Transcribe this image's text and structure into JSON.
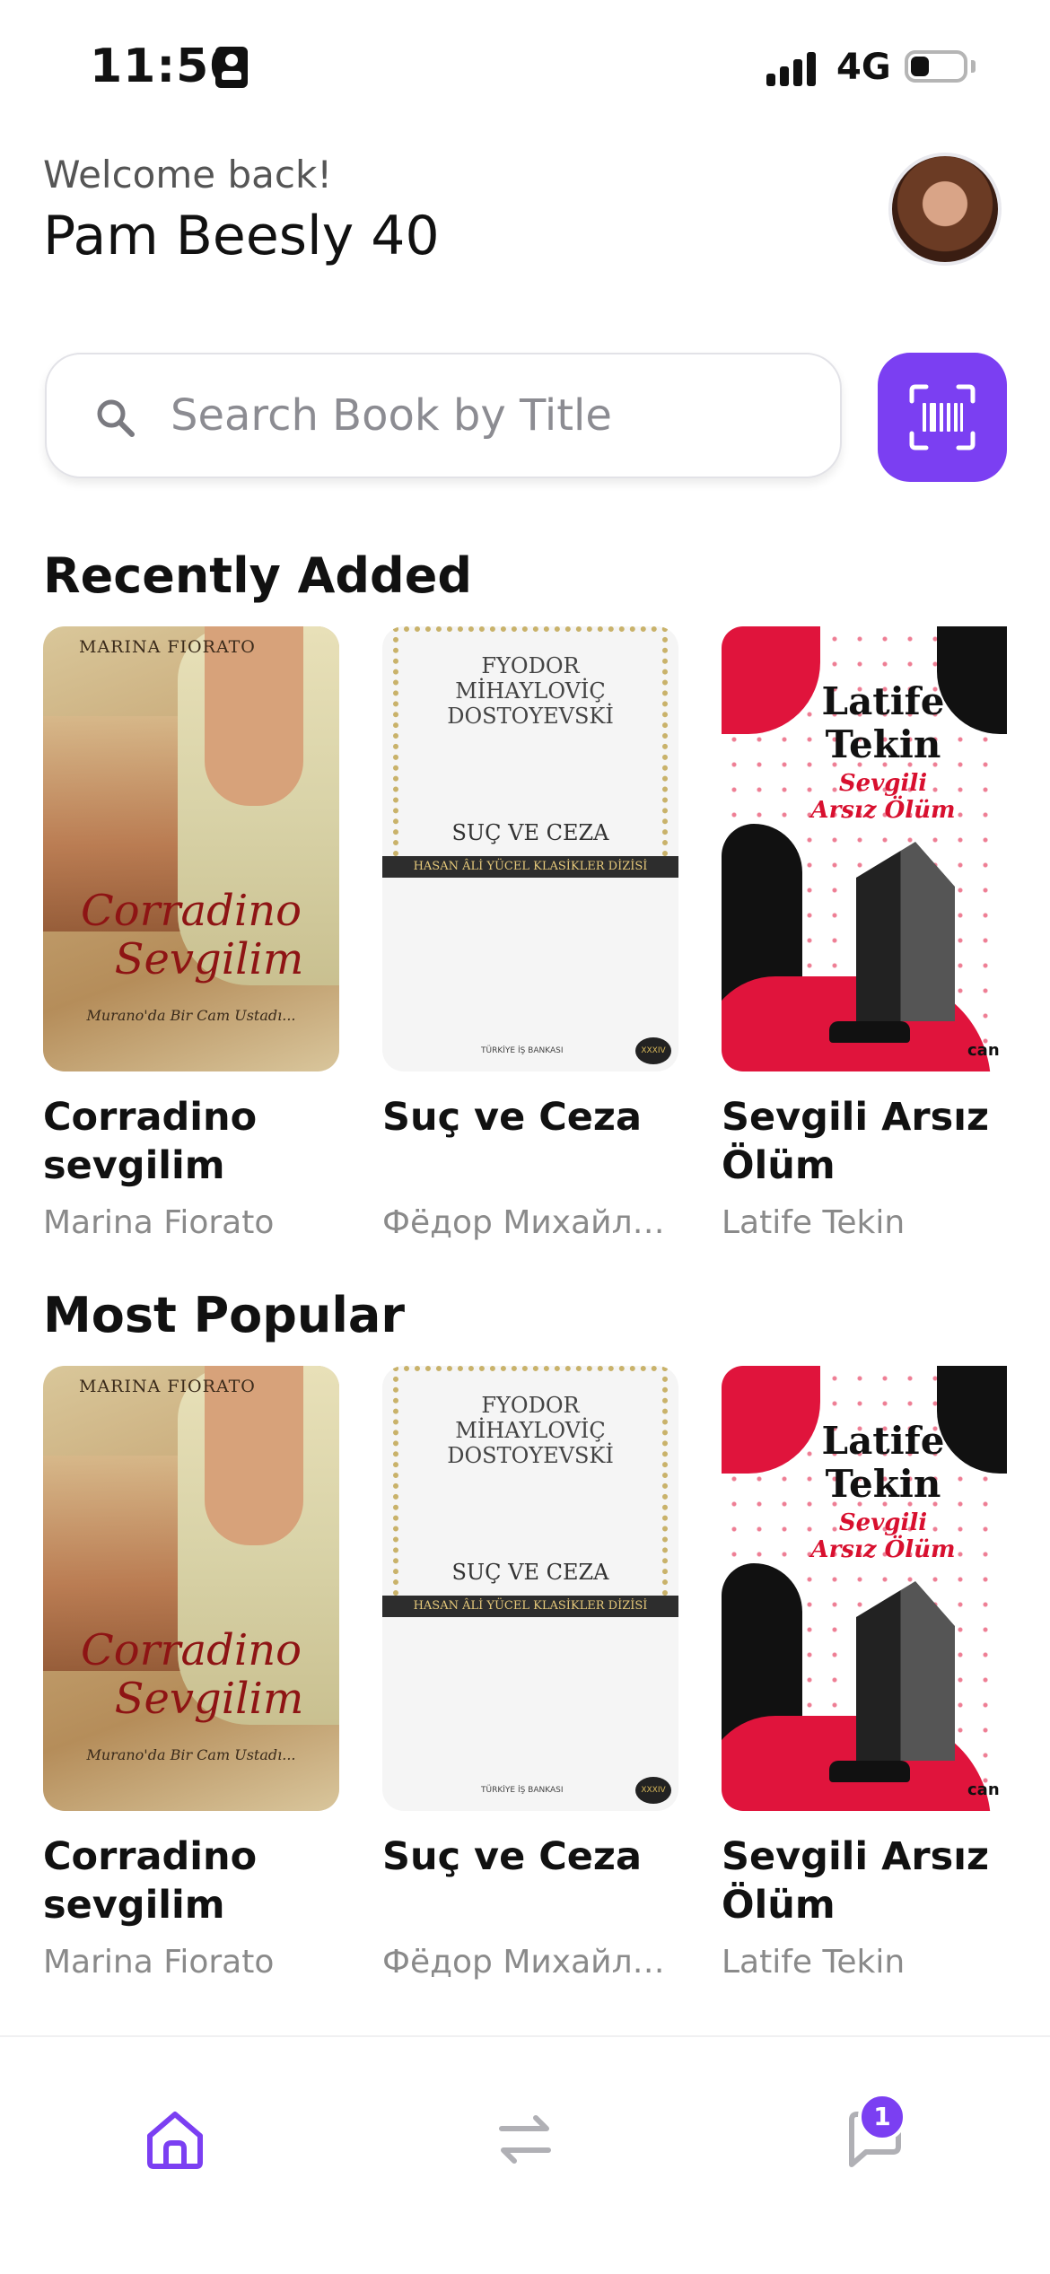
{
  "status_bar": {
    "time": "11:50",
    "network": "4G"
  },
  "header": {
    "welcome": "Welcome back!",
    "username": "Pam Beesly 40"
  },
  "search": {
    "placeholder": "Search Book by Title",
    "value": ""
  },
  "sections": {
    "recent": {
      "title": "Recently Added",
      "books": [
        {
          "title": "Corradino sevgilim",
          "author": "Marina Fiorato"
        },
        {
          "title": "Suç ve Ceza",
          "author": "Фёдор Михайлович Достоевский"
        },
        {
          "title": "Sevgili Arsız Ölüm",
          "author": "Latife Tekin"
        }
      ]
    },
    "popular": {
      "title": "Most Popular",
      "books": [
        {
          "title": "Corradino sevgilim",
          "author": "Marina Fiorato"
        },
        {
          "title": "Suç ve Ceza",
          "author": "Фёдор Михайлович Достоевский"
        },
        {
          "title": "Sevgili Arsız Ölüm",
          "author": "Latife Tekin"
        }
      ]
    }
  },
  "covers": {
    "corradino": {
      "author_line": "MARINA FIORATO",
      "title_line1": "Corradino",
      "title_line2": "Sevgilim",
      "subtitle": "Murano'da Bir Cam Ustadı..."
    },
    "suc": {
      "author_line1": "FYODOR",
      "author_line2": "MİHAYLOVİÇ",
      "author_line3": "DOSTOYEVSKİ",
      "title": "SUÇ VE CEZA",
      "series": "HASAN ÂLİ YÜCEL KLASİKLER DİZİSİ",
      "publisher": "TÜRKİYE İŞ BANKASI",
      "volume": "XXXIV"
    },
    "sevgili": {
      "author_line1": "Latife",
      "author_line2": "Tekin",
      "title_line1": "Sevgili",
      "title_line2": "Arsız Ölüm",
      "publisher": "can"
    }
  },
  "bottom_nav": {
    "messages_badge": "1",
    "icons": [
      "home-icon",
      "swap-icon",
      "chat-icon"
    ]
  },
  "colors": {
    "accent": "#7b3ff2",
    "muted_text": "#8a8a8a",
    "inactive_icon": "#b0b0b5"
  }
}
